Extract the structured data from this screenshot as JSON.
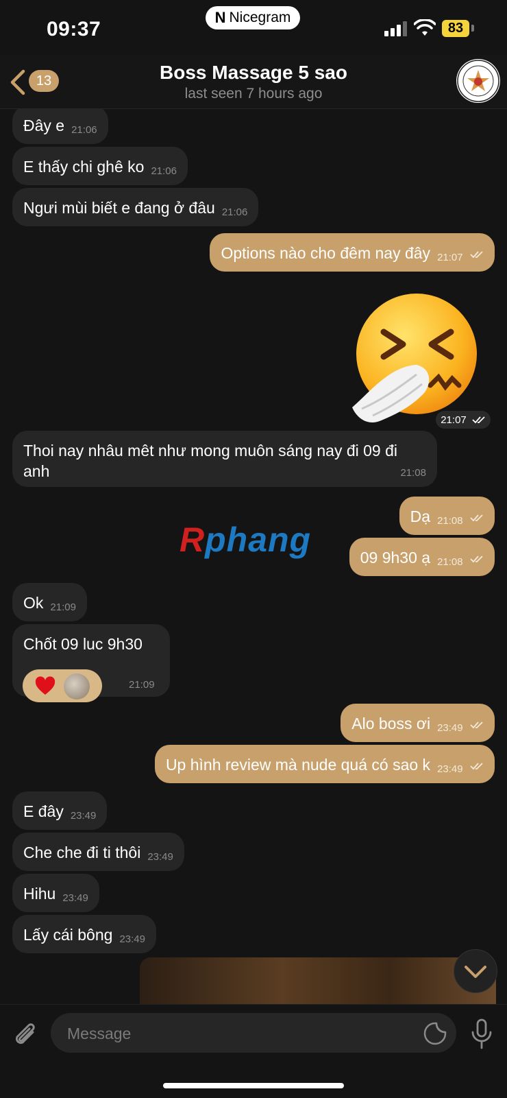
{
  "status": {
    "time": "09:37",
    "app_pill": "Nicegram",
    "app_pill_logo": "N",
    "battery": "83"
  },
  "header": {
    "back_count": "13",
    "title": "Boss Massage 5 sao",
    "subtitle": "last seen 7 hours ago"
  },
  "messages": [
    {
      "dir": "in",
      "text": "Đây e",
      "time": "21:06"
    },
    {
      "dir": "in",
      "text": "E thấy chi ghê ko",
      "time": "21:06"
    },
    {
      "dir": "in",
      "text": "Ngưi mùi biết e đang ở đâu",
      "time": "21:06"
    },
    {
      "dir": "out",
      "text": "Options nào cho đêm nay đây",
      "time": "21:07"
    },
    {
      "dir": "out",
      "type": "sticker",
      "time": "21:07"
    },
    {
      "dir": "in",
      "text_line1": "Thoi nay nhâu mêt như mong muôn sáng nay đi 09 đi",
      "text_line2": "anh",
      "time": "21:08"
    },
    {
      "dir": "out",
      "text": "Dạ",
      "time": "21:08"
    },
    {
      "dir": "out",
      "text": "09 9h30 ạ",
      "time": "21:08"
    },
    {
      "dir": "in",
      "text": "Ok",
      "time": "21:09"
    },
    {
      "dir": "in",
      "text": "Chốt 09 luc 9h30",
      "time": "21:09"
    },
    {
      "dir": "out",
      "text": "Alo boss ơi",
      "time": "23:49"
    },
    {
      "dir": "out",
      "text": "Up hình review mà nude quá có sao k",
      "time": "23:49"
    },
    {
      "dir": "in",
      "text": "E đây",
      "time": "23:49"
    },
    {
      "dir": "in",
      "text": "Che che đi ti thôi",
      "time": "23:49"
    },
    {
      "dir": "in",
      "text": "Hihu",
      "time": "23:49"
    },
    {
      "dir": "in",
      "text": "Lấy cái bông",
      "time": "23:49"
    }
  ],
  "watermark": {
    "first": "R",
    "rest": "phang"
  },
  "input": {
    "placeholder": "Message"
  },
  "colors": {
    "outgoing_bubble": "#c8a06b",
    "incoming_bubble": "#262626",
    "background": "#141414"
  }
}
